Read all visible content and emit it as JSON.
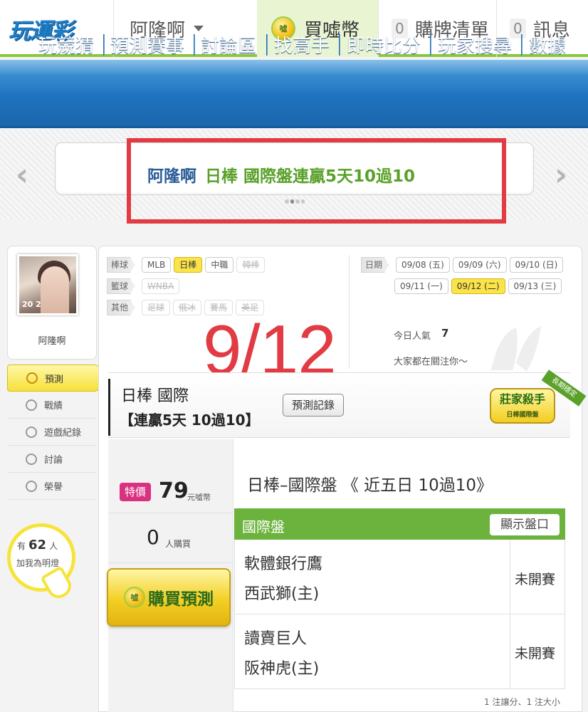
{
  "topbar": {
    "logo_text": "玩運彩",
    "username": "阿隆啊",
    "buy_coin_label": "買噓幣",
    "coin_icon_text": "噓",
    "cart": {
      "count": "0",
      "label": "購牌清單"
    },
    "messages": {
      "count": "0",
      "label": "訊息"
    }
  },
  "nav": {
    "items": [
      "玩競猜",
      "預測賽事",
      "討論區",
      "找高手",
      "即時比分",
      "玩家搜尋",
      "數據"
    ]
  },
  "banner": {
    "name": "阿隆啊",
    "highlight": "日棒 國際盤連贏5天10過10",
    "prev_icon": "‹",
    "next_icon": "›"
  },
  "profile": {
    "name": "阿隆啊",
    "avatar_tag": "20 2",
    "menu": [
      {
        "label": "預測",
        "icon": "target-icon",
        "active": true
      },
      {
        "label": "戰績",
        "icon": "chart-icon",
        "active": false
      },
      {
        "label": "遊戲紀錄",
        "icon": "circle-icon",
        "active": false
      },
      {
        "label": "討論",
        "icon": "chat-icon",
        "active": false
      },
      {
        "label": "榮譽",
        "icon": "medal-icon",
        "active": false
      }
    ],
    "bulb": {
      "prefix": "有",
      "count": "62",
      "suffix": "人",
      "line2": "加我為明燈"
    }
  },
  "filters": {
    "baseball": {
      "label": "棒球",
      "chips": [
        {
          "text": "MLB",
          "state": "normal"
        },
        {
          "text": "日棒",
          "state": "active"
        },
        {
          "text": "中職",
          "state": "normal"
        },
        {
          "text": "韓棒",
          "state": "disabled"
        }
      ]
    },
    "basketball": {
      "label": "籃球",
      "chips": [
        {
          "text": "WNBA",
          "state": "disabled"
        }
      ]
    },
    "other": {
      "label": "其他",
      "chips": [
        {
          "text": "足球",
          "state": "disabled"
        },
        {
          "text": "俄冰",
          "state": "disabled"
        },
        {
          "text": "賽馬",
          "state": "disabled"
        },
        {
          "text": "美足",
          "state": "disabled"
        }
      ]
    },
    "date": {
      "label": "日期",
      "row1": [
        {
          "text": "09/08 (五)",
          "state": "normal"
        },
        {
          "text": "09/09 (六)",
          "state": "normal"
        },
        {
          "text": "09/10 (日)",
          "state": "normal"
        }
      ],
      "row2": [
        {
          "text": "09/11 (一)",
          "state": "normal"
        },
        {
          "text": "09/12 (二)",
          "state": "active"
        },
        {
          "text": "09/13 (三)",
          "state": "normal"
        }
      ]
    }
  },
  "stats": {
    "popularity_label": "今日人氣",
    "popularity_value": "7",
    "follow_text": "大家都在關注你～"
  },
  "overlay_date": "9/12",
  "prediction": {
    "title": "日棒 國際",
    "streak": "【連贏5天 10過10】",
    "record_button": "預測記錄",
    "badge_main": "莊家殺手",
    "badge_sub": "日棒國際盤",
    "ribbon": "長期穩定",
    "special_tag": "特價",
    "price": "79",
    "price_unit": "元噓幣",
    "buyers": "0",
    "buyers_unit": "人購買",
    "buy_button": "購買預測",
    "analysis": "日棒–國際盤 《 近五日 10過10》",
    "table_header": "國際盤",
    "show_odds_button": "顯示盤口",
    "games": [
      {
        "away": "軟體銀行鷹",
        "home": "西武獅(主)",
        "status": "未開賽"
      },
      {
        "away": "讀賣巨人",
        "home": "阪神虎(主)",
        "status": "未開賽"
      }
    ],
    "footnote": "1 注讓分、1 注大小"
  },
  "colors": {
    "accent_green": "#6cb33e",
    "nav_blue": "#1f73bf",
    "highlight_red": "#e23b43",
    "chip_yellow": "#fbe44a"
  }
}
